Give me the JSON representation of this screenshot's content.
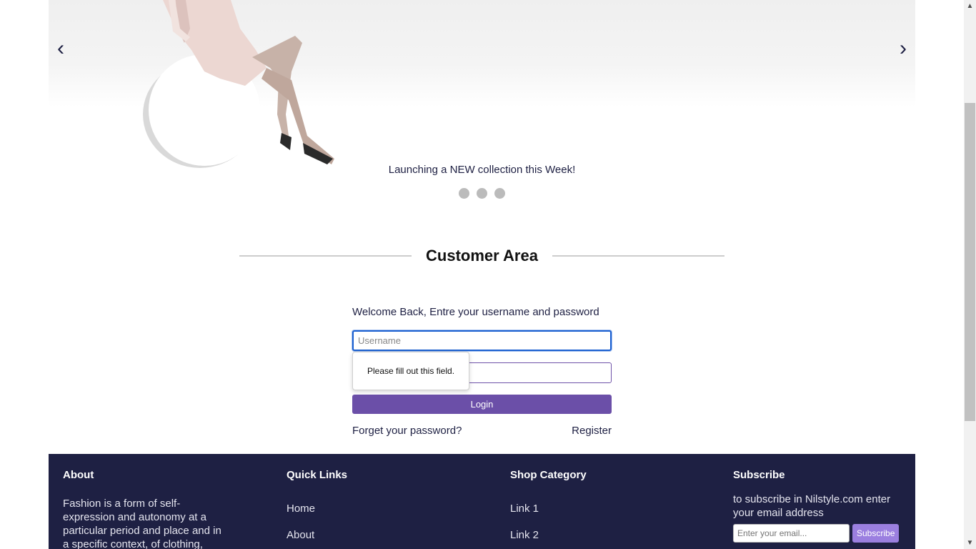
{
  "slider": {
    "prev_arrow": "‹",
    "next_arrow": "›",
    "caption": "Launching a NEW collection this Week!",
    "dots": 3
  },
  "customer_area": {
    "title": "Customer Area",
    "welcome": "Welcome Back, Entre your username and password",
    "username_placeholder": "Username",
    "password_placeholder": "",
    "login_label": "Login",
    "forgot_label": "Forget your password?",
    "register_label": "Register",
    "validation_message": "Please fill out this field."
  },
  "footer": {
    "about": {
      "title": "About",
      "text": "Fashion is a form of self-expression and autonomy at a particular period and place and in a specific context, of clothing,"
    },
    "quick_links": {
      "title": "Quick Links",
      "items": [
        "Home",
        "About"
      ]
    },
    "shop_category": {
      "title": "Shop Category",
      "items": [
        "Link 1",
        "Link 2"
      ]
    },
    "subscribe": {
      "title": "Subscribe",
      "text": "to subscribe in Nilstyle.com enter your email address",
      "placeholder": "Enter your email...",
      "button": "Subscribe"
    }
  },
  "colors": {
    "navy": "#1e2043",
    "purple": "#6b4fa8",
    "focus_blue": "#1a5fd0",
    "subscribe_purple": "#9b7fe0"
  }
}
